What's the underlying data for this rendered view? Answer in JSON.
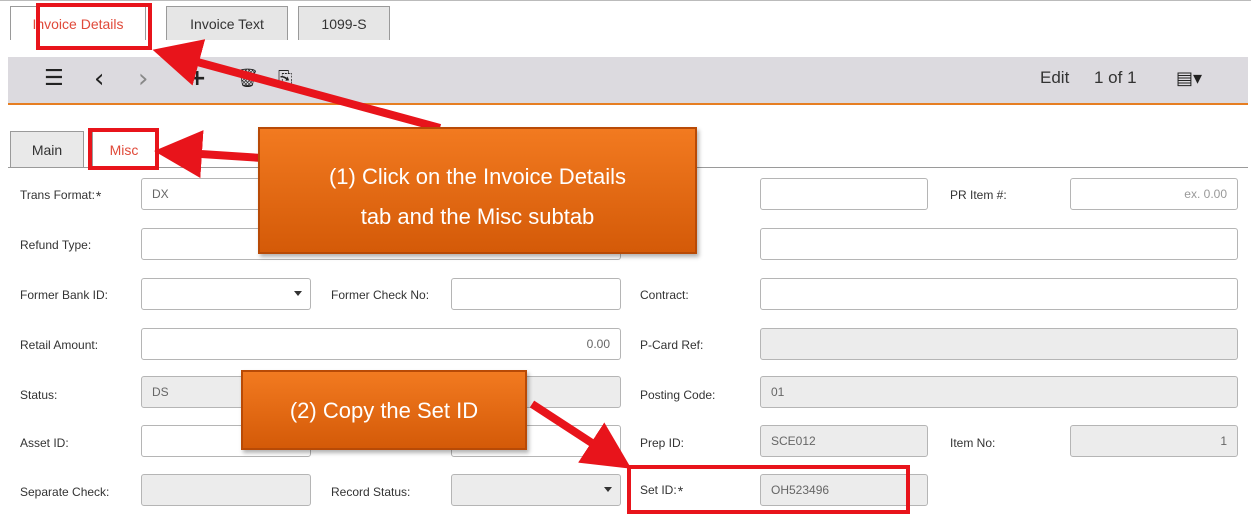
{
  "tabs": [
    "Invoice Details",
    "Invoice Text",
    "1099-S"
  ],
  "toolbar": {
    "list_icon": "list-icon",
    "prev_icon": "chevron-left-icon",
    "next_icon": "chevron-right-icon",
    "add_icon": "plus-icon",
    "delete_icon": "trash-icon",
    "copy_icon": "copy-icon",
    "mode": "Edit",
    "record_position": "1 of 1",
    "view_icon": "view-menu-icon"
  },
  "subtabs": [
    "Main",
    "Misc"
  ],
  "form": {
    "trans_format_label": "Trans Format:",
    "trans_format_value": "DX",
    "pr_item_label": "PR Item #:",
    "pr_item_placeholder": "ex. 0.00",
    "refund_type_label": "Refund Type:",
    "former_bank_label": "Former Bank ID:",
    "former_check_label": "Former Check No:",
    "contract_label": "Contract:",
    "retail_amount_label": "Retail Amount:",
    "retail_amount_value": "0.00",
    "pcard_label": "P-Card Ref:",
    "status_label": "Status:",
    "status_value": "DS",
    "posting_code_label": "Posting Code:",
    "posting_code_value": "01",
    "asset_id_label": "Asset ID:",
    "prep_id_label": "Prep ID:",
    "prep_id_value": "SCE012",
    "item_no_label": "Item No:",
    "item_no_value": "1",
    "separate_check_label": "Separate Check:",
    "record_status_label": "Record Status:",
    "set_id_label": "Set ID:",
    "set_id_value": "OH523496",
    "required_mark": "*"
  },
  "callouts": {
    "step1_line1": "(1)  Click on the Invoice Details",
    "step1_line2": "tab and the Misc subtab",
    "step2": "(2)  Copy the Set ID"
  },
  "colors": {
    "accent": "#e67e22",
    "active_tab_text": "#e04a3a",
    "highlight_red": "#e8141b",
    "callout_orange": "#e86a14"
  }
}
